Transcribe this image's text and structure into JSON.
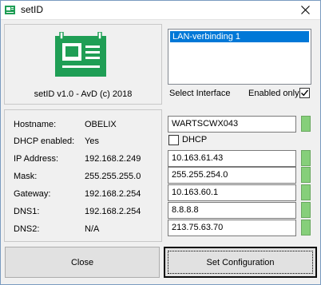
{
  "window": {
    "title": "setID"
  },
  "about": {
    "version_text": "setID v1.0 - AvD (c) 2018"
  },
  "interfaces": {
    "items": [
      "LAN-verbinding 1"
    ],
    "select_label": "Select Interface",
    "enabled_only_label": "Enabled only",
    "enabled_only_checked": true
  },
  "current": {
    "rows": [
      {
        "label": "Hostname:",
        "value": "OBELIX"
      },
      {
        "label": "DHCP enabled:",
        "value": "Yes"
      },
      {
        "label": "IP Address:",
        "value": "192.168.2.249"
      },
      {
        "label": "Mask:",
        "value": "255.255.255.0"
      },
      {
        "label": "Gateway:",
        "value": "192.168.2.254"
      },
      {
        "label": "DNS1:",
        "value": "192.168.2.254"
      },
      {
        "label": "DNS2:",
        "value": "N/A"
      }
    ]
  },
  "config": {
    "hostname": "WARTSCWX043",
    "dhcp_label": "DHCP",
    "dhcp_checked": false,
    "ip": "10.163.61.43",
    "mask": "255.255.254.0",
    "gateway": "10.163.60.1",
    "dns1": "8.8.8.8",
    "dns2": "213.75.63.70"
  },
  "status_color": "#86cf7a",
  "buttons": {
    "close_label": "Close",
    "set_label": "Set Configuration"
  }
}
